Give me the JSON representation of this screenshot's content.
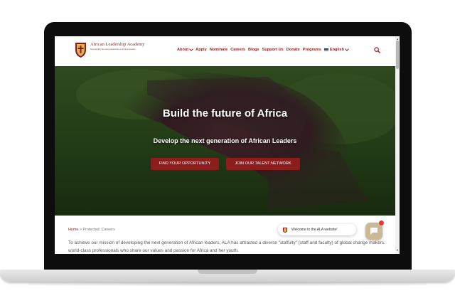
{
  "header": {
    "logo_name": "African Leadership Academy",
    "logo_tagline": "Developing the next generation of African leaders",
    "nav": [
      {
        "label": "About",
        "dropdown": true
      },
      {
        "label": "Apply",
        "dropdown": false
      },
      {
        "label": "Nominate",
        "dropdown": false
      },
      {
        "label": "Careers",
        "dropdown": false
      },
      {
        "label": "Blogs",
        "dropdown": false
      },
      {
        "label": "Support Us",
        "dropdown": false
      },
      {
        "label": "Donate",
        "dropdown": false
      },
      {
        "label": "Programs",
        "dropdown": false
      },
      {
        "label": "English",
        "dropdown": true,
        "icon": "uk-flag-icon"
      }
    ],
    "search_icon": "search-icon"
  },
  "hero": {
    "title": "Build the future of Africa",
    "subtitle": "Develop the next generation of African Leaders",
    "buttons": {
      "primary": "FIND YOUR OPPORTUNITY",
      "secondary": "JOIN OUR TALENT NETWORK"
    }
  },
  "breadcrumb": {
    "home": "Home",
    "separator": " > ",
    "current": "Protected: Careers"
  },
  "body": {
    "text": "To achieve our mission of developing the next generation of African leaders, ALA has attracted a diverse \"staffulty\" (staff and faculty) of global change makers: world-class professionals who share our values and passion for Africa and her youth."
  },
  "chat": {
    "greeting": "Welcome to the ALA website!",
    "launcher_icon": "chat-icon"
  },
  "colors": {
    "brand_red": "#a3201f",
    "button_red": "#8c1d1d",
    "chat_gold": "#cbb995",
    "badge_red": "#e8363b"
  }
}
